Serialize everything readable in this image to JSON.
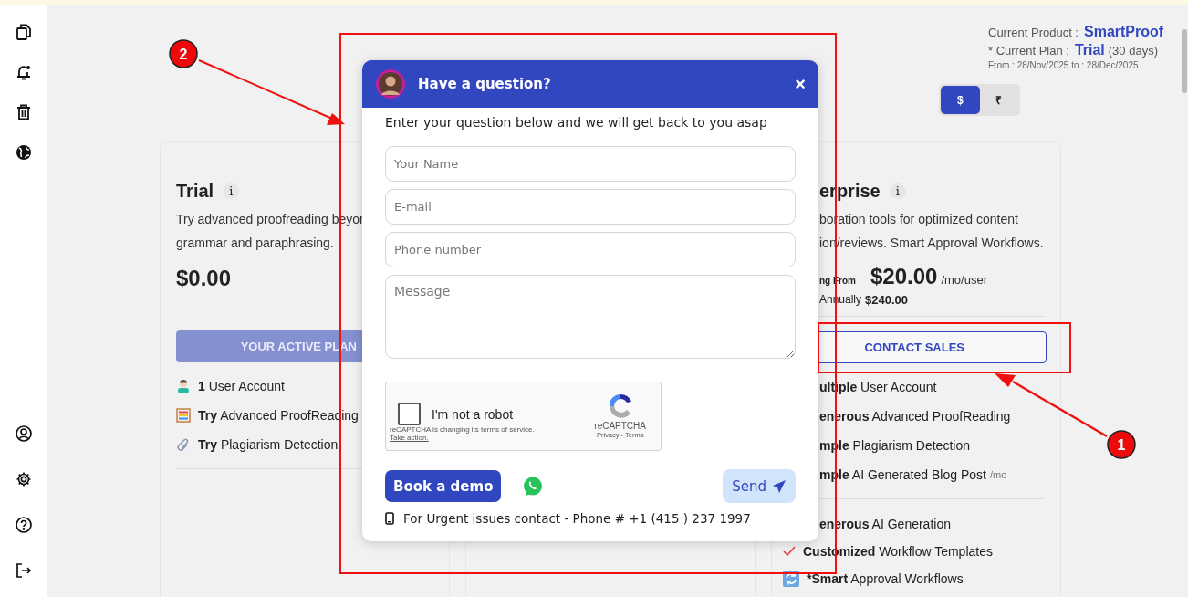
{
  "sidebar": {
    "top_icons": [
      {
        "kind": "documents"
      },
      {
        "kind": "bell"
      },
      {
        "kind": "trash"
      },
      {
        "kind": "globe"
      }
    ],
    "bottom_icons": [
      {
        "kind": "user"
      },
      {
        "kind": "settings"
      },
      {
        "kind": "help"
      },
      {
        "kind": "logout"
      }
    ]
  },
  "product_info": {
    "product_label": "Current Product :",
    "product": "SmartProof",
    "plan_label": "* Current Plan :",
    "plan": "Trial",
    "plan_duration": "(30 days)",
    "period": "From : 28/Nov/2025 to : 28/Dec/2025"
  },
  "currency_toggle": [
    {
      "label": "$",
      "selected": true
    },
    {
      "label": "₹",
      "selected": false
    }
  ],
  "trial_card": {
    "title": "Trial",
    "info": "i",
    "description_lines": [
      "Try advanced proofreading beyor",
      "grammar and paraphrasing."
    ],
    "price": "$0.00",
    "button": "YOUR ACTIVE PLAN",
    "features": [
      {
        "kind": "person",
        "text": "**1** User Account"
      },
      {
        "kind": "abacus",
        "text": "**Try** Advanced ProofReading"
      },
      {
        "kind": "paperclip",
        "text": "**Try** Plagiarism Detection"
      }
    ]
  },
  "enterprise_card": {
    "title": "erprise",
    "info": "i",
    "description_lines": [
      "boration tools for optimized content",
      "ion/reviews. Smart Approval Workflows."
    ],
    "price_prefix": "ng From",
    "price": "$20.00",
    "price_unit": "/mo/user",
    "annual_label": "Annually",
    "annual_price": "$240.00",
    "button": "CONTACT SALES",
    "features": [
      {
        "text": "**ultiple** User Account"
      },
      {
        "text": "**enerous** Advanced ProofReading"
      },
      {
        "text": "**mple** Plagiarism Detection"
      },
      {
        "text": "**mple** AI Generated Blog Post",
        "suffix": "/mo"
      }
    ],
    "extra_features": [
      {
        "kind": "plain",
        "text": "**enerous** AI Generation"
      },
      {
        "kind": "check",
        "text": "**Customized** Workflow Templates"
      },
      {
        "kind": "refresh",
        "text": "***Smart** Approval Workflows"
      }
    ]
  },
  "chat_dialog": {
    "title": "Have a question?",
    "close": "×",
    "subtitle": "Enter your question below and we will get back to you asap",
    "fields": [
      {
        "placeholder": "Your Name"
      },
      {
        "placeholder": "E-mail"
      },
      {
        "placeholder": "Phone number"
      }
    ],
    "message": {
      "placeholder": "Message"
    },
    "captcha": {
      "checked": false,
      "label": "I'm not a robot",
      "notice": "reCAPTCHA is changing its terms of service.",
      "notice_link": "Take action.",
      "brand": "reCAPTCHA",
      "links": "Privacy - Terms"
    },
    "book_button": "Book a demo",
    "send_button": "Send",
    "footer": "For Urgent issues contact - Phone # +1 (415 ) 237 1997"
  },
  "annotations": {
    "markers": [
      {
        "label": "2"
      },
      {
        "label": "1"
      }
    ]
  }
}
